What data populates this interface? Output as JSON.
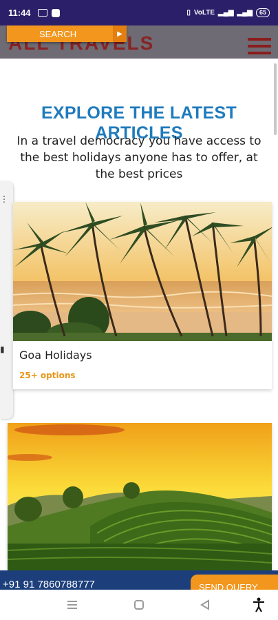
{
  "status_bar": {
    "time": "11:44",
    "network_text": "VoLTE",
    "battery": "65"
  },
  "header": {
    "logo_text": "ALL TRAVELS",
    "search_label": "SEARCH"
  },
  "section": {
    "heading": "EXPLORE THE LATEST ARTICLES",
    "subheading": "In a travel democracy you have access to the best holidays anyone has to offer, at the best prices"
  },
  "cards": [
    {
      "title": "Goa Holidays",
      "options": "25+ options"
    }
  ],
  "footer": {
    "phone": "+91 91 7860788777",
    "send_query": "SEND QUERY"
  },
  "colors": {
    "accent_orange": "#f2961d",
    "heading_blue": "#1f7bbd",
    "status_purple": "#2a1f68",
    "footer_navy": "#1c3f7c"
  },
  "icons": [
    "menu-icon",
    "chevron-right-icon",
    "home-icon",
    "back-icon",
    "recents-icon",
    "accessibility-icon"
  ]
}
